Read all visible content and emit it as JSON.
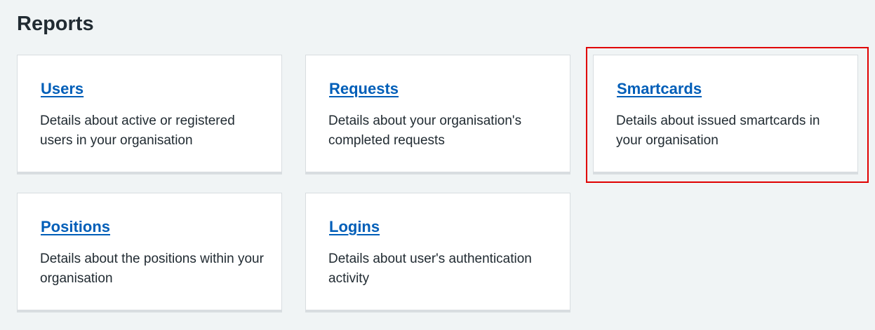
{
  "page": {
    "title": "Reports"
  },
  "cards": [
    {
      "title": "Users",
      "description": "Details about active or registered users in your organisation"
    },
    {
      "title": "Requests",
      "description": "Details about your organisation's completed requests"
    },
    {
      "title": "Smartcards",
      "description": "Details about issued smartcards in your organisation"
    },
    {
      "title": "Positions",
      "description": "Details about the positions within your organisation"
    },
    {
      "title": "Logins",
      "description": "Details about user's authentication activity"
    }
  ],
  "colors": {
    "background": "#f0f4f5",
    "link": "#005eb8",
    "text": "#212b32",
    "card_border": "#d8dde0",
    "highlight": "#e00000"
  }
}
